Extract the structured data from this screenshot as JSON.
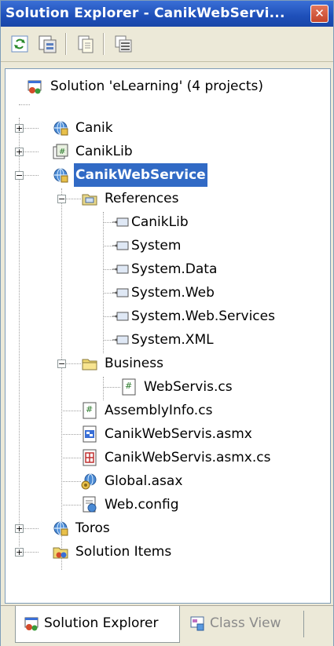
{
  "window": {
    "title": "Solution Explorer - CanikWebServi...",
    "close_glyph": "✕"
  },
  "toolbar": {
    "buttons": [
      {
        "icon": "refresh-icon"
      },
      {
        "icon": "show-all-files-icon"
      },
      {
        "icon": "properties-icon"
      },
      {
        "icon": "copy-project-icon"
      }
    ]
  },
  "tree": {
    "solution": "Solution 'eLearning' (4 projects)",
    "nodes": [
      {
        "label": "Canik",
        "icon": "web-project-icon"
      },
      {
        "label": "CanikLib",
        "icon": "library-project-icon"
      },
      {
        "label": "CanikWebService",
        "icon": "web-project-icon",
        "selected": true
      },
      {
        "label": "References",
        "icon": "references-folder-icon"
      },
      {
        "label": "CanikLib",
        "icon": "reference-icon"
      },
      {
        "label": "System",
        "icon": "reference-icon"
      },
      {
        "label": "System.Data",
        "icon": "reference-icon"
      },
      {
        "label": "System.Web",
        "icon": "reference-icon"
      },
      {
        "label": "System.Web.Services",
        "icon": "reference-icon"
      },
      {
        "label": "System.XML",
        "icon": "reference-icon"
      },
      {
        "label": "Business",
        "icon": "folder-icon"
      },
      {
        "label": "WebServis.cs",
        "icon": "cs-file-icon"
      },
      {
        "label": "AssemblyInfo.cs",
        "icon": "cs-file-icon"
      },
      {
        "label": "CanikWebServis.asmx",
        "icon": "asmx-file-icon"
      },
      {
        "label": "CanikWebServis.asmx.cs",
        "icon": "asmx-cs-file-icon"
      },
      {
        "label": "Global.asax",
        "icon": "asax-file-icon"
      },
      {
        "label": "Web.config",
        "icon": "config-file-icon"
      },
      {
        "label": "Toros",
        "icon": "web-project-icon"
      },
      {
        "label": "Solution Items",
        "icon": "solution-items-icon"
      }
    ],
    "expander_plus": "+",
    "expander_minus": "−"
  },
  "tabs": {
    "solution_explorer": "Solution Explorer",
    "class_view": "Class View"
  },
  "colors": {
    "title_bar": "#1e4fb9",
    "selection": "#316ac5",
    "panel": "#ece9d8"
  }
}
